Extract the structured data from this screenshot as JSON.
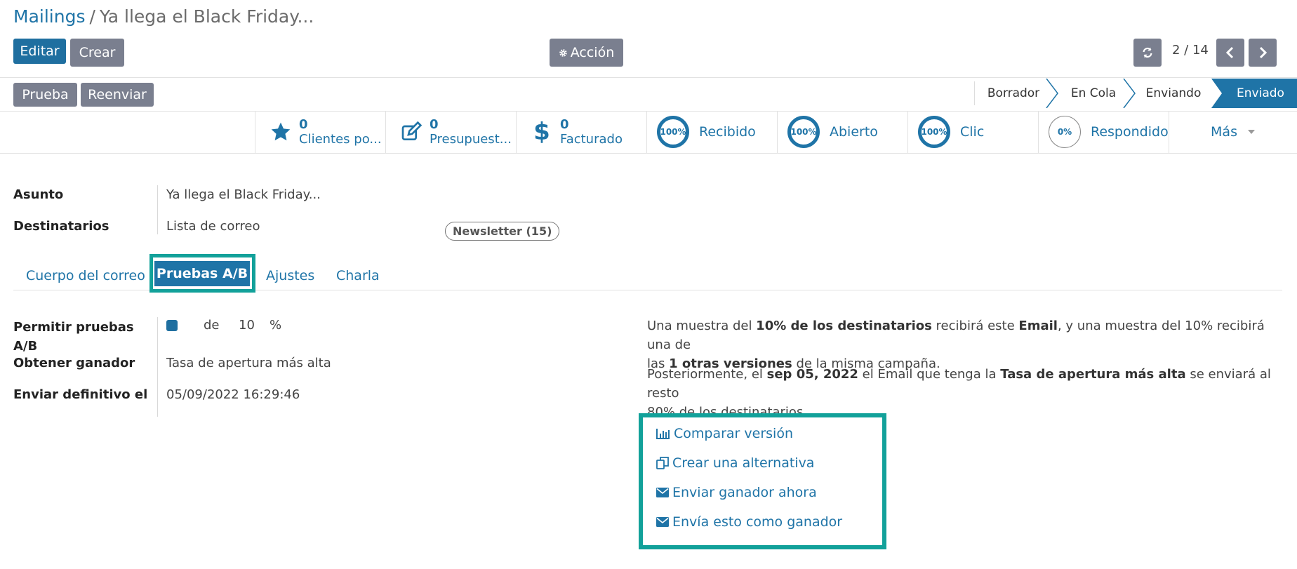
{
  "breadcrumb": {
    "root": "Mailings",
    "separator": "/",
    "current": "Ya llega el Black Friday..."
  },
  "toolbar": {
    "edit_label": "Editar",
    "create_label": "Crear",
    "action_label": "Acción",
    "pager": "2 / 14"
  },
  "header_buttons": {
    "test_label": "Prueba",
    "resend_label": "Reenviar"
  },
  "status_bar": {
    "stages": [
      "Borrador",
      "En Cola",
      "Enviando",
      "Enviado"
    ],
    "active": "Enviado"
  },
  "stats": {
    "customers": {
      "count": "0",
      "label": "Clientes po..."
    },
    "quotations": {
      "count": "0",
      "label": "Presupuest..."
    },
    "invoiced": {
      "count": "0",
      "label": "Facturado"
    },
    "received": {
      "percent": "100%",
      "label": "Recibido"
    },
    "opened": {
      "percent": "100%",
      "label": "Abierto"
    },
    "clicked": {
      "percent": "100%",
      "label": "Clic"
    },
    "replied": {
      "percent": "0%",
      "label": "Respondido"
    },
    "more_label": "Más"
  },
  "form": {
    "subject_label": "Asunto",
    "subject_value": "Ya llega el Black Friday...",
    "recipients_label": "Destinatarios",
    "recipients_value": "Lista de correo",
    "recipients_tag": "Newsletter (15)"
  },
  "tabs": [
    "Cuerpo del correo",
    "Pruebas A/B",
    "Ajustes",
    "Charla"
  ],
  "ab": {
    "allow_label_1": "Permitir pruebas",
    "allow_label_2": "A/B",
    "de": "de",
    "percent_value": "10",
    "percent_sign": "%",
    "winner_label": "Obtener ganador",
    "winner_value": "Tasa de apertura más alta",
    "send_final_label": "Enviar definitivo el",
    "send_final_value": "05/09/2022 16:29:46"
  },
  "info": {
    "p1_a": "Una muestra del ",
    "p1_b": "10% de los destinatarios",
    "p1_c": " recibirá este ",
    "p1_d": "Email",
    "p1_e": ", y una muestra del 10% recibirá una de",
    "p1_f": "las ",
    "p1_g": "1 otras versiones",
    "p1_h": " de la misma campaña.",
    "p2_a": "Posteriormente, el ",
    "p2_b": "sep 05, 2022",
    "p2_c": " el Email que tenga la ",
    "p2_d": "Tasa de apertura más alta",
    "p2_e": " se enviará al resto",
    "p2_f": "80% de los destinatarios."
  },
  "actions": {
    "compare": "Comparar versión",
    "alternative": "Crear una alternativa",
    "send_winner_now": "Enviar ganador ahora",
    "send_as_winner": "Envía esto como ganador"
  },
  "colors": {
    "primary": "#1f74a7",
    "highlight": "#12a19a",
    "secondary": "#7a7f8f"
  }
}
